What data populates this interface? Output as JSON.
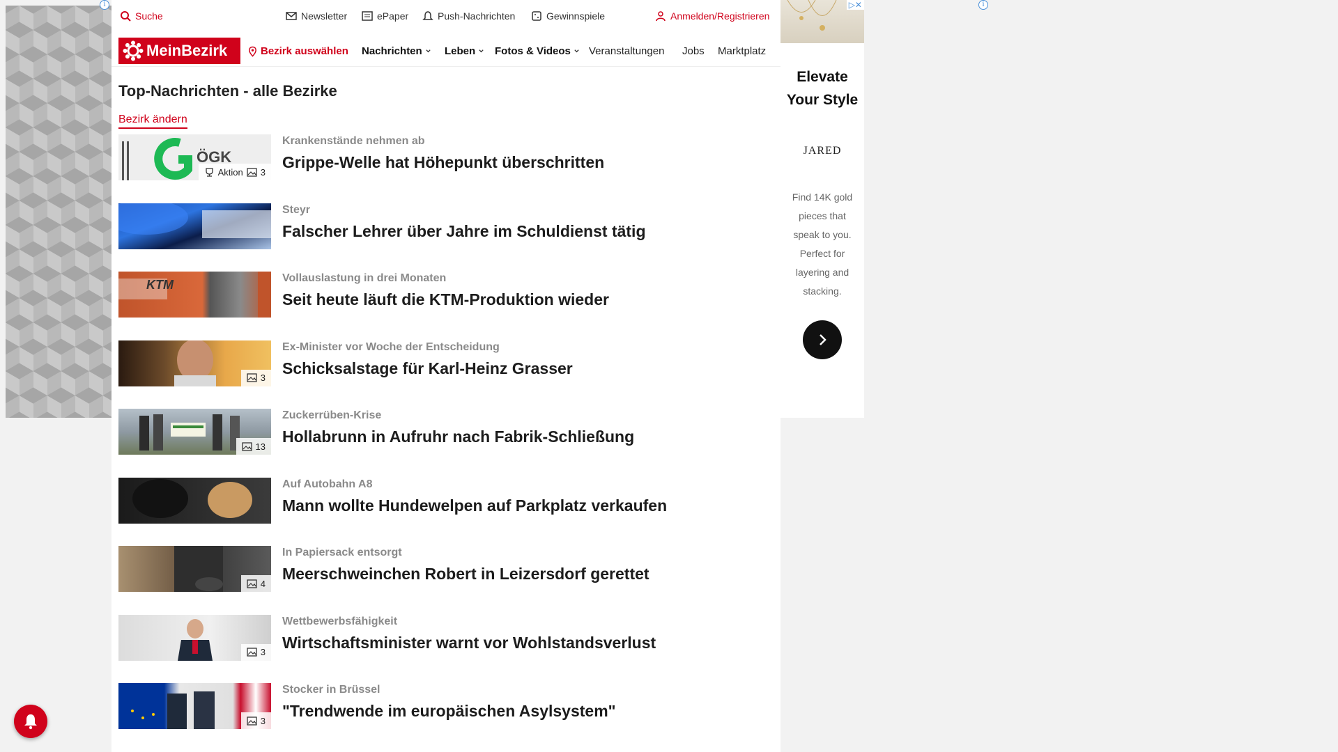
{
  "utility": {
    "search": "Suche",
    "newsletter": "Newsletter",
    "epaper": "ePaper",
    "push": "Push-Nachrichten",
    "games": "Gewinnspiele",
    "login": "Anmelden/Registrieren"
  },
  "nav": {
    "logo": "MeinBezirk",
    "district": "Bezirk auswählen",
    "items": [
      "Nachrichten",
      "Leben",
      "Fotos & Videos",
      "Veranstaltungen",
      "Jobs",
      "Marktplatz"
    ]
  },
  "section": {
    "title": "Top-Nachrichten - alle Bezirke",
    "change": "Bezirk ändern"
  },
  "articles": [
    {
      "kicker": "Krankenstände nehmen ab",
      "headline": "Grippe-Welle hat Höhepunkt überschritten",
      "badge_label": "Aktion",
      "badge_count": "3"
    },
    {
      "kicker": "Steyr",
      "headline": "Falscher Lehrer über Jahre im Schuldienst tätig",
      "badge_label": "",
      "badge_count": ""
    },
    {
      "kicker": "Vollauslastung in drei Monaten",
      "headline": "Seit heute läuft die KTM-Produktion wieder",
      "badge_label": "",
      "badge_count": ""
    },
    {
      "kicker": "Ex-Minister vor Woche der Entscheidung",
      "headline": "Schicksalstage für Karl-Heinz Grasser",
      "badge_label": "",
      "badge_count": "3"
    },
    {
      "kicker": "Zuckerrüben-Krise",
      "headline": "Hollabrunn in Aufruhr nach Fabrik-Schließung",
      "badge_label": "",
      "badge_count": "13"
    },
    {
      "kicker": "Auf Autobahn A8",
      "headline": "Mann wollte Hundewelpen auf Parkplatz verkaufen",
      "badge_label": "",
      "badge_count": ""
    },
    {
      "kicker": "In Papiersack entsorgt",
      "headline": "Meerschweinchen Robert in Leizersdorf gerettet",
      "badge_label": "",
      "badge_count": "4"
    },
    {
      "kicker": "Wettbewerbsfähigkeit",
      "headline": "Wirtschaftsminister warnt vor Wohlstandsverlust",
      "badge_label": "",
      "badge_count": "3"
    },
    {
      "kicker": "Stocker in Brüssel",
      "headline": "\"Trendwende im europäischen Asylsystem\"",
      "badge_label": "",
      "badge_count": "3"
    }
  ],
  "ad": {
    "title_line1": "Elevate",
    "title_line2": "Your Style",
    "brand": "JARED",
    "copy": "Find 14K gold pieces that speak to you. Perfect for layering and stacking."
  },
  "colors": {
    "brand_red": "#d0021b"
  }
}
